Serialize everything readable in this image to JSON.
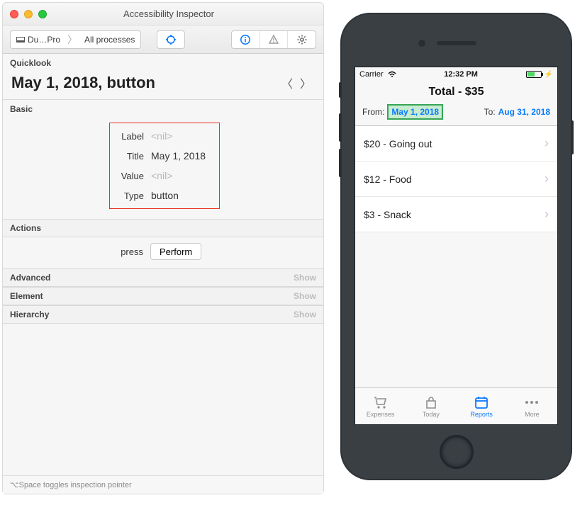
{
  "inspector": {
    "window_title": "Accessibility Inspector",
    "breadcrumb": {
      "device": "Du…Pro",
      "target": "All processes"
    },
    "quicklook": {
      "heading": "Quicklook",
      "title": "May 1, 2018, button"
    },
    "sections": {
      "basic": {
        "label": "Basic",
        "rows": {
          "label_key": "Label",
          "label_val": "<nil>",
          "title_key": "Title",
          "title_val": "May 1, 2018",
          "value_key": "Value",
          "value_val": "<nil>",
          "type_key": "Type",
          "type_val": "button"
        }
      },
      "actions": {
        "label": "Actions",
        "press_label": "press",
        "perform_label": "Perform"
      },
      "advanced": {
        "label": "Advanced",
        "show": "Show"
      },
      "element": {
        "label": "Element",
        "show": "Show"
      },
      "hierarchy": {
        "label": "Hierarchy",
        "show": "Show"
      }
    },
    "hint": "⌥Space toggles inspection pointer"
  },
  "phone": {
    "status": {
      "carrier": "Carrier",
      "time": "12:32 PM"
    },
    "header": {
      "title": "Total - $35",
      "from_label": "From:",
      "from_value": "May 1, 2018",
      "to_label": "To:",
      "to_value": "Aug 31, 2018"
    },
    "list": [
      {
        "text": "$20 - Going out"
      },
      {
        "text": "$12 - Food"
      },
      {
        "text": "$3 - Snack"
      }
    ],
    "tabs": {
      "expenses": "Expenses",
      "today": "Today",
      "reports": "Reports",
      "more": "More"
    }
  },
  "colors": {
    "accent": "#0a7aff",
    "highlight_border": "#ea3323"
  }
}
